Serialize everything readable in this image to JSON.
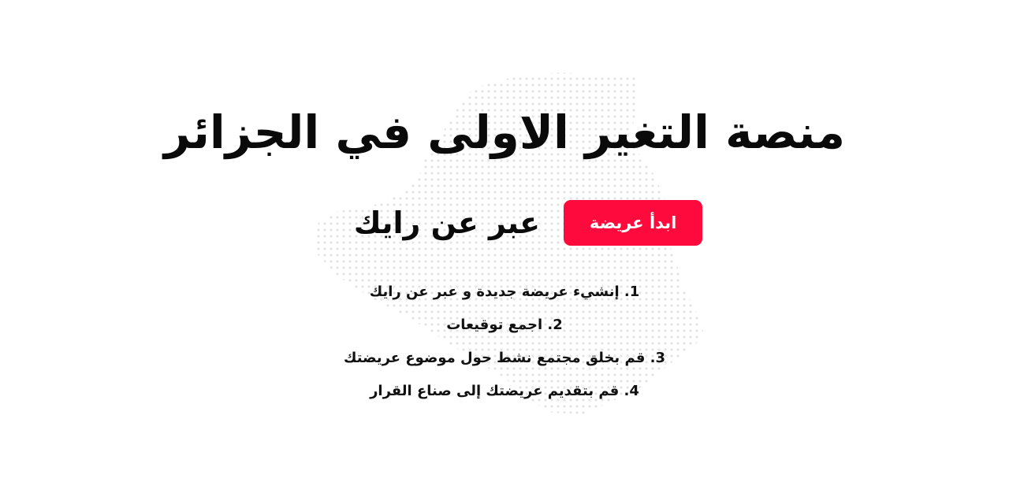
{
  "hero": {
    "headline": "منصة التغير الاولى في الجزائر",
    "tagline": "عبر عن رايك",
    "cta_label": "ابدأ عريضة"
  },
  "steps": [
    "1. إنشيء عريضة جديدة و عبر عن رايك",
    "2. اجمع توقيعات",
    "3. قم بخلق مجتمع نشط حول موضوع عريضتك",
    "4. قم بتقديم عريضتك إلى صناع القرار"
  ],
  "colors": {
    "accent": "#ff0a3c",
    "text": "#0a0a0a",
    "map_dots": "#e4e4e4"
  }
}
